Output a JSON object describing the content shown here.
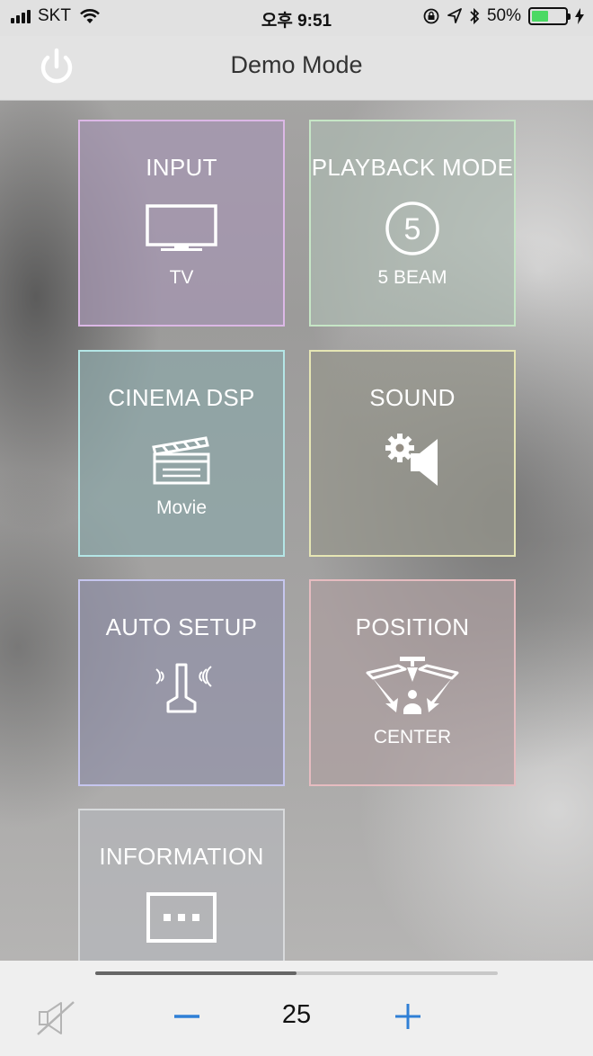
{
  "status_bar": {
    "carrier": "SKT",
    "time": "오후 9:51",
    "battery_percent": "50%",
    "battery_level": 0.5,
    "colors": {
      "battery_fill": "#4cd964"
    }
  },
  "navbar": {
    "title": "Demo Mode",
    "power_icon": "power-icon"
  },
  "tiles": {
    "input": {
      "title": "INPUT",
      "value": "TV",
      "icon": "tv-icon"
    },
    "playback_mode": {
      "title": "PLAYBACK MODE",
      "value": "5 BEAM",
      "icon": "five-circle-icon",
      "icon_text": "5"
    },
    "cinema_dsp": {
      "title": "CINEMA DSP",
      "value": "Movie",
      "icon": "clapperboard-icon"
    },
    "sound": {
      "title": "SOUND",
      "icon": "gear-speaker-icon"
    },
    "auto_setup": {
      "title": "AUTO SETUP",
      "icon": "microphone-icon"
    },
    "position": {
      "title": "POSITION",
      "value": "CENTER",
      "icon": "listener-position-icon"
    },
    "information": {
      "title": "INFORMATION",
      "icon": "info-dots-icon"
    }
  },
  "volume": {
    "value": "25",
    "level": 0.5,
    "mute_icon": "mute-speaker-icon",
    "minus_icon": "minus-icon",
    "plus_icon": "plus-icon",
    "colors": {
      "accent": "#2f7fd6"
    }
  }
}
